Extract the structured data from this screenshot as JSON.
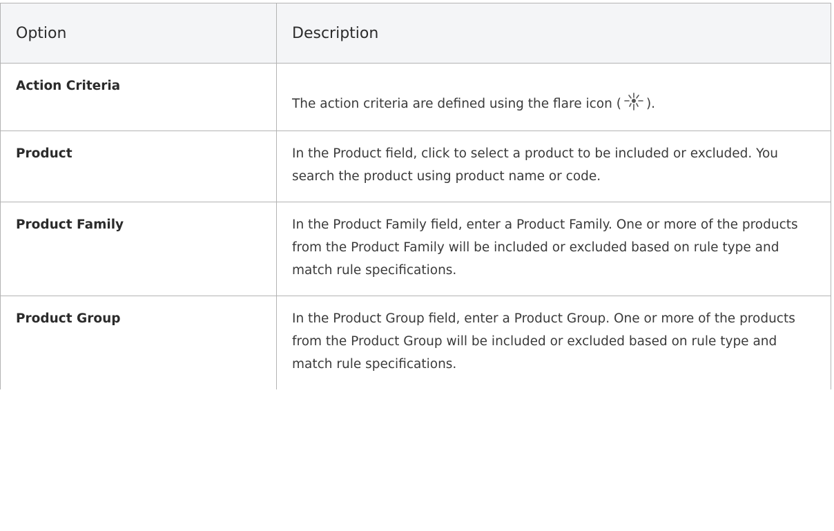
{
  "table": {
    "headers": [
      "Option",
      "Description"
    ],
    "rows": [
      {
        "option": "Action Criteria",
        "description_before": "The action criteria are defined using the flare icon (",
        "description_after": ")."
      },
      {
        "option": "Product",
        "description": "In the Product field, click to select a product to be included or excluded. You search the product using product name or code."
      },
      {
        "option": "Product Family",
        "description": "In the Product Family field, enter a Product Family. One or more of the products from the Product Family will be included or excluded based on rule type and match rule specifications."
      },
      {
        "option": "Product Group",
        "description": "In the Product Group field, enter a Product Group. One or more of the products from the Product Group will be included or excluded based on rule type and match rule specifications."
      }
    ]
  },
  "icons": {
    "flare": "flare-icon"
  }
}
